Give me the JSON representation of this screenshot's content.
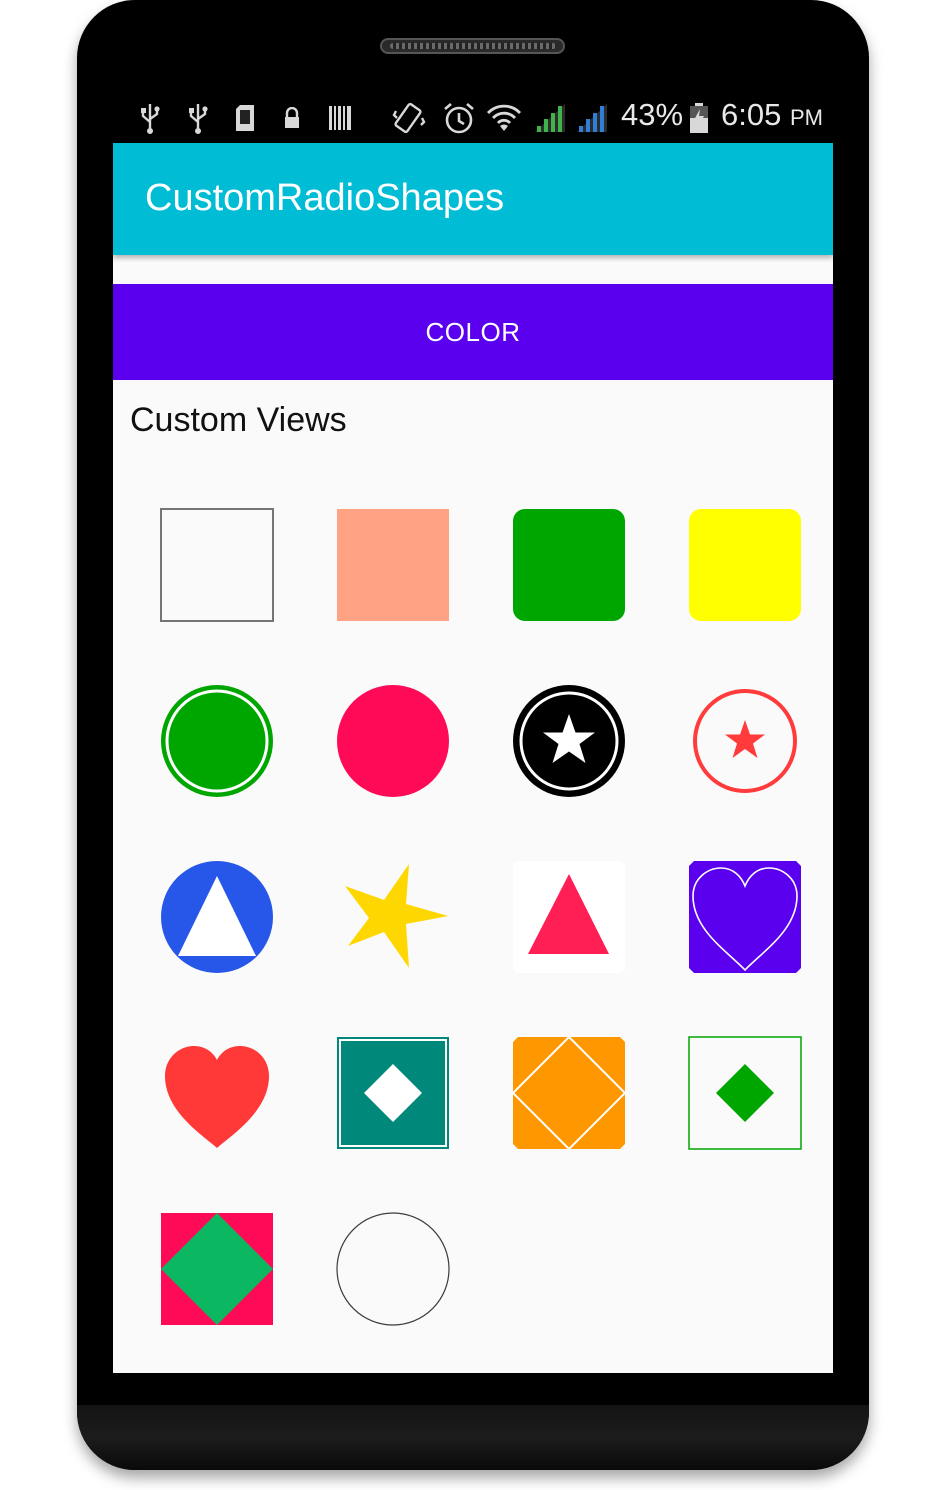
{
  "status_bar": {
    "icons": [
      "usb-icon",
      "usb-icon",
      "sd-card-icon",
      "lock-icon",
      "barcode-icon",
      "vibrate-icon",
      "alarm-icon",
      "wifi-icon",
      "signal-green-icon",
      "signal-blue-icon",
      "battery-charging-icon"
    ],
    "battery": "43%",
    "time": "6:05",
    "ampm": "PM"
  },
  "app_bar": {
    "title": "CustomRadioShapes",
    "color": "#00bcd4"
  },
  "color_button": {
    "label": "COLOR",
    "color": "#5a00ee"
  },
  "section": {
    "title": "Custom Views"
  },
  "shapes": [
    {
      "name": "outlined-square-shape",
      "stroke": "#757575"
    },
    {
      "name": "salmon-square-shape",
      "fill": "#ffa183"
    },
    {
      "name": "green-rounded-square-shape",
      "fill": "#00a600"
    },
    {
      "name": "yellow-rounded-square-shape",
      "fill": "#ffff00"
    },
    {
      "name": "green-ringed-circle-shape",
      "fill": "#00a600"
    },
    {
      "name": "pink-circle-shape",
      "fill": "#ff0a57"
    },
    {
      "name": "black-star-circle-shape",
      "fill": "#000000"
    },
    {
      "name": "red-star-ring-shape",
      "stroke": "#ff3b3b"
    },
    {
      "name": "blue-triangle-circle-shape",
      "fill": "#2757e8"
    },
    {
      "name": "yellow-star-shape",
      "fill": "#ffd700"
    },
    {
      "name": "red-triangle-square-shape",
      "fill": "#ff1f55"
    },
    {
      "name": "purple-heart-square-shape",
      "fill": "#5a00ee"
    },
    {
      "name": "red-heart-shape",
      "fill": "#ff3838"
    },
    {
      "name": "teal-diamond-square-shape",
      "fill": "#00897b"
    },
    {
      "name": "orange-diamond-square-shape",
      "fill": "#ff9800"
    },
    {
      "name": "green-diamond-outlined-square-shape",
      "fill": "#00a600"
    },
    {
      "name": "pink-green-diamond-shape",
      "fill": "#ff0a57"
    },
    {
      "name": "outlined-circle-shape",
      "stroke": "#3a3a3a"
    }
  ]
}
